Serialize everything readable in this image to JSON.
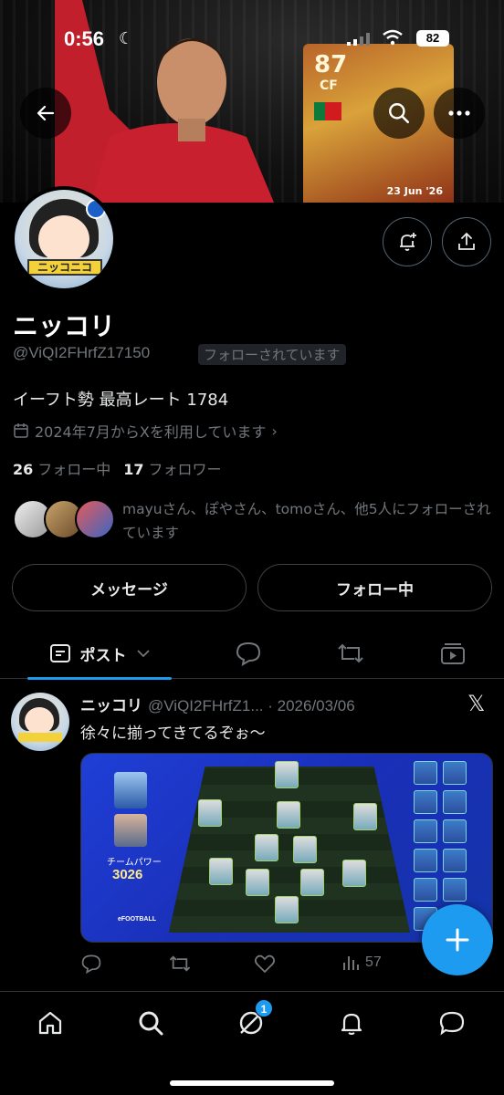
{
  "status_bar": {
    "time": "0:56",
    "battery": "82"
  },
  "banner": {
    "card_rating": "87",
    "card_position": "CF",
    "card_date": "23 Jun '26"
  },
  "profile": {
    "display_name": "ニッコリ",
    "handle": "@ViQI2FHrfZ17150",
    "follows_you": "フォローされています",
    "avatar_text": "ニッコニコ",
    "bio": "イーフト勢 最高レート 1784",
    "joined": "2024年7月からXを利用しています",
    "following_count": "26",
    "following_label": "フォロー中",
    "followers_count": "17",
    "followers_label": "フォロワー",
    "followed_by": "mayuさん、ぽやさん、tomoさん、他5人にフォローされています"
  },
  "buttons": {
    "message": "メッセージ",
    "following": "フォロー中"
  },
  "tabs": {
    "posts": "ポスト"
  },
  "post": {
    "name": "ニッコリ",
    "meta": "@ViQI2FHrfZ1... · 2026/03/06",
    "text": "徐々に揃ってきてるぞぉ〜",
    "team_power_label": "チームパワー",
    "team_power": "3026",
    "brand": "eFOOTBALL",
    "views": "57"
  },
  "nav": {
    "grok_badge": "1"
  },
  "colors": {
    "accent": "#1d9bf0",
    "background": "#000000",
    "muted": "#71767b"
  },
  "icons": [
    "back-arrow-icon",
    "search-icon",
    "more-icon",
    "bell-plus-icon",
    "share-icon",
    "calendar-icon",
    "reply-icon",
    "repost-icon",
    "like-icon",
    "views-icon",
    "home-icon",
    "grok-icon",
    "bell-icon",
    "messages-icon",
    "plus-icon",
    "x-logo-icon"
  ]
}
